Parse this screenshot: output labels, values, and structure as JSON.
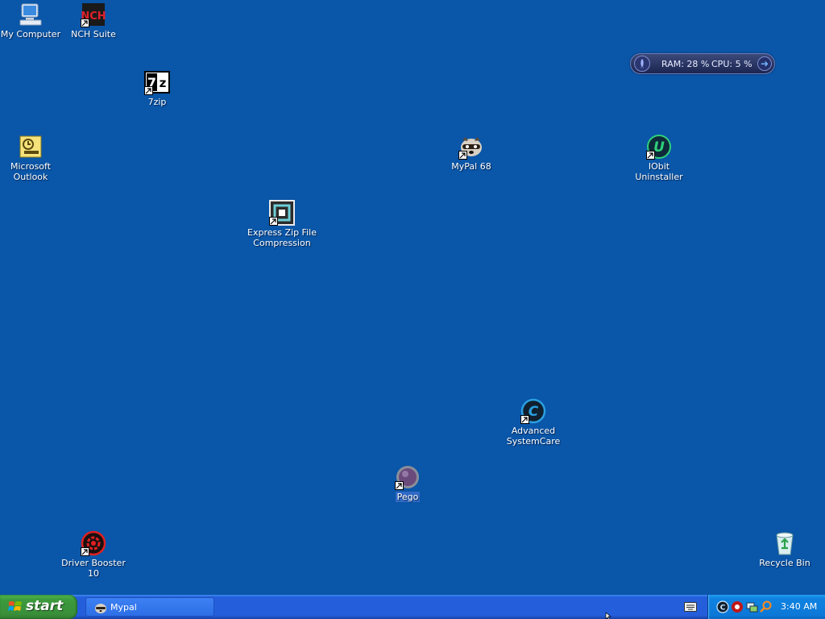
{
  "desktop": {
    "background_color": "#0a56a8",
    "icons": {
      "my_computer": {
        "label": "My Computer",
        "icon": "my-computer-icon"
      },
      "nch_suite": {
        "label": "NCH Suite",
        "icon": "nch-suite-icon"
      },
      "sevenzip": {
        "label": "7zip",
        "icon": "7zip-icon"
      },
      "outlook": {
        "label": "Microsoft\nOutlook",
        "icon": "outlook-icon"
      },
      "express_zip": {
        "label": "Express Zip File\nCompression",
        "icon": "express-zip-icon"
      },
      "mypal": {
        "label": "MyPal 68",
        "icon": "mypal-raccoon-icon"
      },
      "iobit": {
        "label": "IObit\nUninstaller",
        "icon": "iobit-uninstaller-icon"
      },
      "asc": {
        "label": "Advanced\nSystemCare",
        "icon": "advanced-systemcare-icon"
      },
      "pego": {
        "label": "Pego",
        "icon": "pego-icon"
      },
      "driver_booster": {
        "label": "Driver Booster\n10",
        "icon": "driver-booster-icon"
      },
      "recycle_bin": {
        "label": "Recycle Bin",
        "icon": "recycle-bin-icon"
      }
    }
  },
  "gadget": {
    "ram": "RAM: 28 %",
    "cpu": "CPU: 5 %"
  },
  "taskbar": {
    "start_label": "start",
    "tasks": [
      {
        "label": "Mypal",
        "icon": "mypal-raccoon-icon"
      }
    ],
    "tray": {
      "icons": [
        "advanced-systemcare-tray-icon",
        "driver-booster-tray-icon",
        "network-tray-icon",
        "search-tray-icon"
      ],
      "clock": "3:40 AM"
    }
  }
}
